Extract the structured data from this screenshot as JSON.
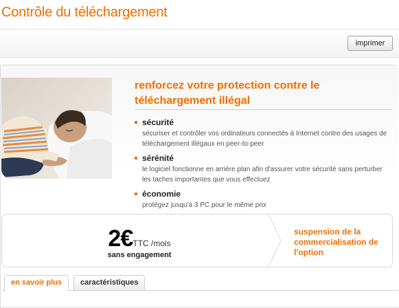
{
  "page": {
    "title": "Contrôle du téléchargement"
  },
  "toolbar": {
    "print_label": "imprimer"
  },
  "offer": {
    "title": "renforcez votre protection contre le téléchargement illégal",
    "features": [
      {
        "title": "sécurité",
        "description": "sécuriser et contrôler vos ordinateurs connectés à Internet contre des usages de téléchargement illégaux en peer-to-peer"
      },
      {
        "title": "sérénité",
        "description": "le logiciel fonctionne en arrière plan afin d'assurer votre sécurité sans perturber les taches importantes que vous effectuez"
      },
      {
        "title": "économie",
        "description": "protégez jusqu'à 3 PC pour le même prix"
      }
    ]
  },
  "pricing": {
    "amount": "2€",
    "suffix": "TTC /mois",
    "engagement": "sans engagement",
    "notice": "suspension de la commercialisation de l'option"
  },
  "tabs": [
    {
      "label": "en savoir plus",
      "active": true
    },
    {
      "label": "caractéristiques",
      "active": false
    }
  ],
  "colors": {
    "accent": "#f16e00",
    "text": "#333333",
    "border": "#d8d8d8"
  },
  "hero_image": {
    "subject": "child sleeping on a white pillow"
  }
}
